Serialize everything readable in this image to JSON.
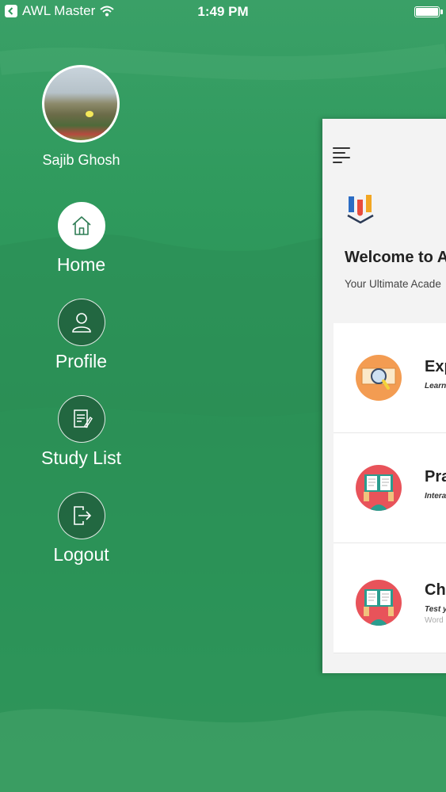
{
  "status_bar": {
    "app_name": "AWL Master",
    "time": "1:49 PM"
  },
  "menu": {
    "user_name": "Sajib Ghosh",
    "items": [
      {
        "label": "Home",
        "icon": "home-icon",
        "active": true
      },
      {
        "label": "Profile",
        "icon": "user-icon",
        "active": false
      },
      {
        "label": "Study List",
        "icon": "document-edit-icon",
        "active": false
      },
      {
        "label": "Logout",
        "icon": "logout-icon",
        "active": false
      }
    ]
  },
  "main": {
    "welcome": "Welcome to A",
    "tagline": "Your Ultimate Acade",
    "cards": [
      {
        "title": "Exp",
        "subtitle": "Learn",
        "subtitle2": "",
        "icon": "magnifier-book-icon"
      },
      {
        "title": "Pra",
        "subtitle": "Intera",
        "subtitle2": "",
        "icon": "reading-person-icon"
      },
      {
        "title": "Cha",
        "subtitle": "Test y",
        "subtitle2": "Word",
        "icon": "reading-person-icon"
      }
    ]
  },
  "colors": {
    "background": "#2f9a5d",
    "active_circle": "#ffffff",
    "panel": "#f3f3f3"
  }
}
